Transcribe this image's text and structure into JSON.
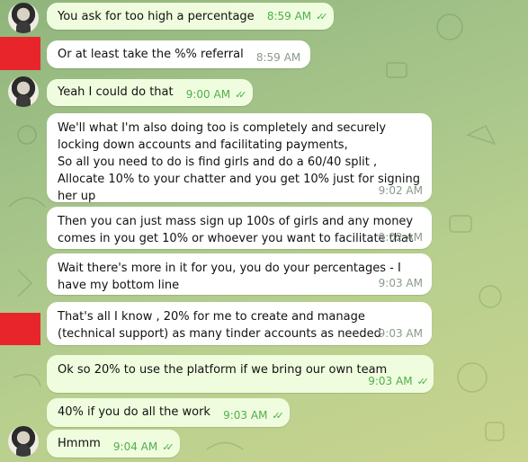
{
  "colors": {
    "outgoing_bubble": "#effdde",
    "incoming_bubble": "#ffffff",
    "time_outgoing": "#4fae4e",
    "time_incoming": "#8a9a8a",
    "redaction": "#e8252a"
  },
  "messages": [
    {
      "text": "You ask for too high a percentage",
      "time": "8:59 AM",
      "read": "✓✓"
    },
    {
      "text": "Or at least take the %% referral",
      "time": "8:59 AM"
    },
    {
      "text": "Yeah I could do that",
      "time": "9:00 AM",
      "read": "✓✓"
    },
    {
      "text": "We'll what I'm also doing too is completely and securely locking down accounts and facilitating payments,\nSo all you need to do is find girls and do a 60/40 split ,\nAllocate 10% to your chatter and you get 10% just for signing her up",
      "time": "9:02 AM"
    },
    {
      "text": "Then you can just mass sign up 100s of girls and any money comes in you get 10% or whoever you want to facilitate that",
      "time": "9:02 AM"
    },
    {
      "text": "Wait there's more in it for you, you do your percentages - I have my bottom line",
      "time": "9:03 AM"
    },
    {
      "text": "That's all I know , 20% for me to create and manage (technical support) as many tinder accounts as needed",
      "time": "9:03 AM"
    },
    {
      "text": "Ok so 20% to use the platform if we bring our own team",
      "time": "9:03 AM",
      "read": "✓✓"
    },
    {
      "text": "40% if you do all the work",
      "time": "9:03 AM",
      "read": "✓✓"
    },
    {
      "text": "Hmmm",
      "time": "9:04 AM",
      "read": "✓✓"
    }
  ]
}
